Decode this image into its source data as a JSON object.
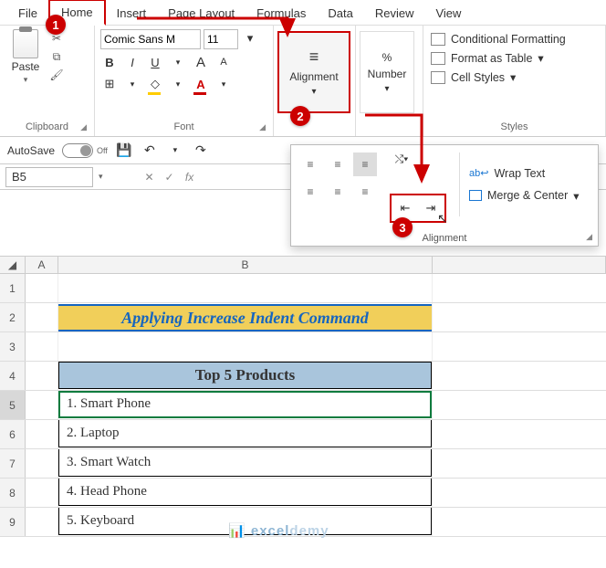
{
  "tabs": [
    "File",
    "Home",
    "Insert",
    "Page Layout",
    "Formulas",
    "Data",
    "Review",
    "View"
  ],
  "active_tab": "Home",
  "clipboard": {
    "label": "Clipboard",
    "paste": "Paste"
  },
  "font": {
    "label": "Font",
    "family": "Comic Sans M",
    "size": "11",
    "bold": "B",
    "italic": "I",
    "underline": "U",
    "incA": "A",
    "decA": "A"
  },
  "alignment": {
    "big_label": "Alignment"
  },
  "number": {
    "big_label": "Number"
  },
  "styles": {
    "label": "Styles",
    "cond": "Conditional Formatting",
    "table": "Format as Table",
    "cell": "Cell Styles"
  },
  "qat": {
    "autosave": "AutoSave",
    "off": "Off"
  },
  "namebox": "B5",
  "popup": {
    "wrap": "Wrap Text",
    "merge": "Merge & Center",
    "foot": "Alignment"
  },
  "callouts": {
    "c1": "1",
    "c2": "2",
    "c3": "3"
  },
  "col_headers": [
    "A",
    "B"
  ],
  "rows": [
    "1",
    "2",
    "3",
    "4",
    "5",
    "6",
    "7",
    "8",
    "9"
  ],
  "title": "Applying Increase Indent Command",
  "table_header": "Top 5 Products",
  "products": [
    "1. Smart Phone",
    "2. Laptop",
    "3. Smart Watch",
    "4. Head Phone",
    "5. Keyboard"
  ],
  "watermark": {
    "a": "excel",
    "b": "demy"
  }
}
